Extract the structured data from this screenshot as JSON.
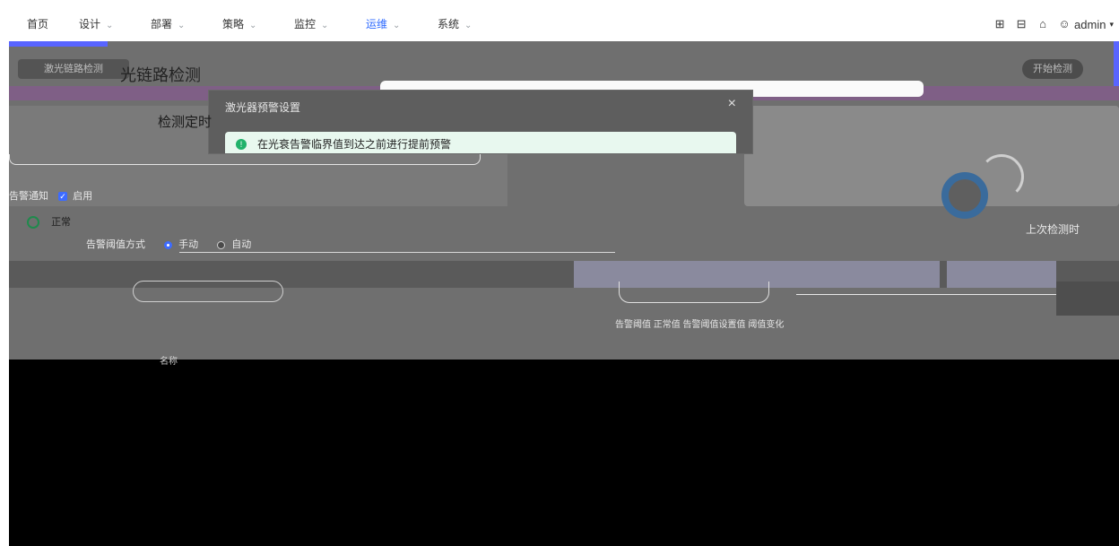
{
  "topnav": {
    "items": [
      {
        "label": "首页",
        "has_dropdown": false,
        "active": false
      },
      {
        "label": "设计",
        "has_dropdown": true,
        "active": false
      },
      {
        "label": "部署",
        "has_dropdown": true,
        "active": false
      },
      {
        "label": "策略",
        "has_dropdown": true,
        "active": false
      },
      {
        "label": "监控",
        "has_dropdown": true,
        "active": false
      },
      {
        "label": "运维",
        "has_dropdown": true,
        "active": true
      },
      {
        "label": "系统",
        "has_dropdown": true,
        "active": false
      }
    ],
    "chevron": "⌄",
    "user": "admin",
    "icons": [
      "apps-grid-icon",
      "monitor-icon",
      "shirt-icon",
      "user-icon",
      "caret-down-icon"
    ]
  },
  "page": {
    "tab_label": "激光链路检测",
    "title": "光链路检测",
    "detect_button": "开始检测",
    "detect_time_label": "检测定时",
    "last_detect": "上次检测时",
    "alert_label": "告警通知",
    "enabled_label": "启用",
    "status_label": "正常",
    "ref_mode_label": "告警阈值方式",
    "ref_options": [
      "手动",
      "自动"
    ],
    "legend": "告警阈值 正常值  告警阈值设置值  阈值变化",
    "column_head": "名称"
  },
  "modal": {
    "title": "激光器预警设置",
    "close": "×",
    "alert_text": "在光衰告警临界值到达之前进行提前预警"
  },
  "colors": {
    "accent": "#2f6bff",
    "success": "#21b26b",
    "overlay": "#6f6f6f"
  }
}
